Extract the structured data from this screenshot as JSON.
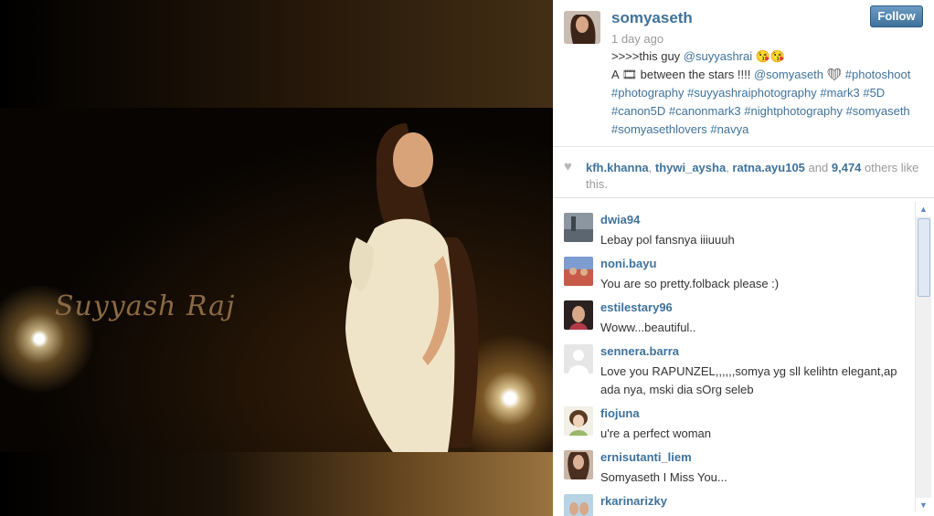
{
  "photo": {
    "watermark": "Suyyash Raj"
  },
  "post": {
    "username": "somyaseth",
    "timestamp": "1 day ago",
    "follow_label": "Follow",
    "caption_line1_prefix": ">>>>this guy ",
    "caption_mention": "@suyyashrai",
    "caption_emoji": "😘😘",
    "caption_line2_prefix": "A 🎞 between the stars !!!! ",
    "caption_mention2": "@somyaseth",
    "caption_heart": " ❤ ",
    "hashtags": "#photoshoot #photography #suyyashraiphotography #mark3 #5D #canon5D #canonmark3 #nightphotography #somyaseth #somyasethlovers #navya"
  },
  "likes": {
    "users": [
      "kfh.khanna",
      "thywi_aysha",
      "ratna.ayu105"
    ],
    "and_label": "and",
    "count": "9,474",
    "suffix": "others like this."
  },
  "comments": [
    {
      "user": "dwia94",
      "text": "Lebay pol fansnya iiiuuuh"
    },
    {
      "user": "noni.bayu",
      "text": "You are so pretty.folback please :)"
    },
    {
      "user": "estilestary96",
      "text": "Woww...beautiful.."
    },
    {
      "user": "sennera.barra",
      "text": "Love you RAPUNZEL,,,,,,somya yg sll kelihtn elegant,ap ada nya, mski dia sOrg seleb"
    },
    {
      "user": "fiojuna",
      "text": "u're a perfect woman"
    },
    {
      "user": "ernisutanti_liem",
      "text": "Somyaseth I Miss You..."
    },
    {
      "user": "rkarinarizky",
      "text": ""
    }
  ],
  "colors": {
    "link": "#3f729b",
    "muted": "#999999",
    "follow_bg": "#3f729b"
  }
}
